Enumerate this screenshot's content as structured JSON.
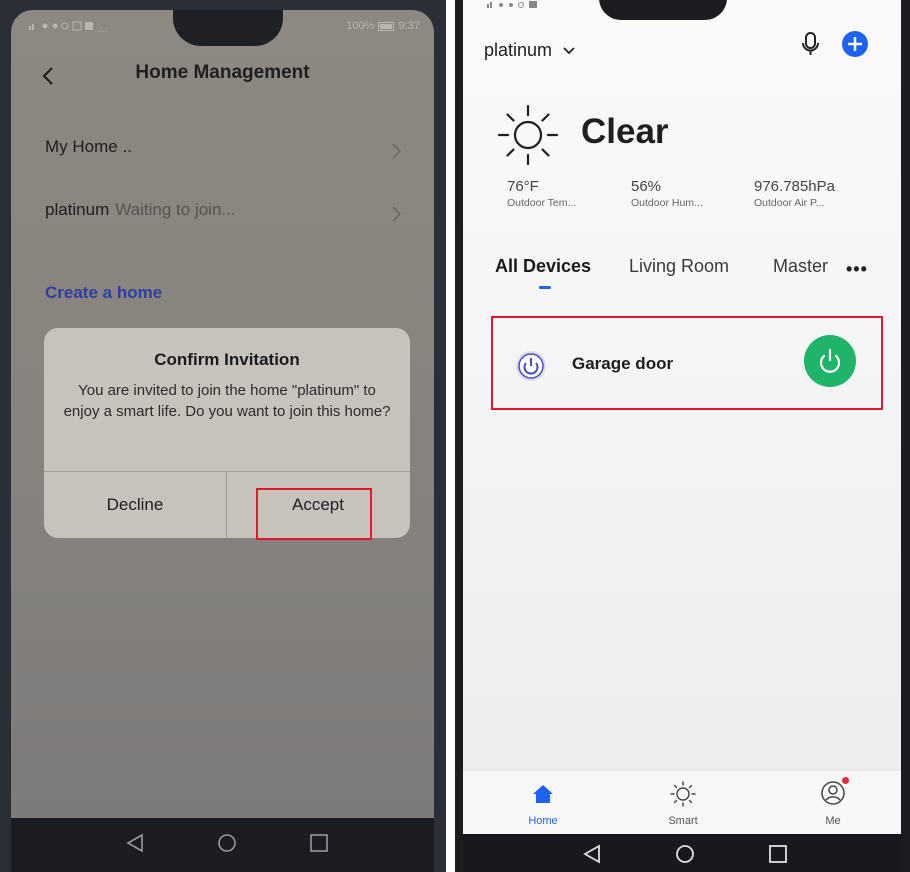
{
  "left": {
    "status": {
      "left_icons": "…",
      "battery": "100%",
      "time": "9:37"
    },
    "header": {
      "title": "Home Management"
    },
    "rows": [
      {
        "name": "My Home ..",
        "status": ""
      },
      {
        "name": "platinum",
        "status": "Waiting to join..."
      }
    ],
    "create_home": "Create a home",
    "dialog": {
      "title": "Confirm Invitation",
      "message": "You are invited to join the home \"platinum\" to enjoy a smart life. Do you want to join this home?",
      "decline": "Decline",
      "accept": "Accept"
    }
  },
  "right": {
    "home_name": "platinum",
    "weather": {
      "condition": "Clear",
      "temp": {
        "value": "76°F",
        "label": "Outdoor Tem..."
      },
      "humidity": {
        "value": "56%",
        "label": "Outdoor Hum..."
      },
      "pressure": {
        "value": "976.785hPa",
        "label": "Outdoor Air P..."
      }
    },
    "tabs": [
      "All Devices",
      "Living Room",
      "Master"
    ],
    "more": "•••",
    "device": {
      "name": "Garage door",
      "power": "on"
    },
    "bottom_nav": [
      {
        "label": "Home",
        "icon": "home-icon",
        "active": true
      },
      {
        "label": "Smart",
        "icon": "sun-icon",
        "active": false
      },
      {
        "label": "Me",
        "icon": "profile-icon",
        "active": false
      }
    ],
    "colors": {
      "accent": "#1e62f0",
      "power_on": "#20b36a",
      "highlight": "#e0182a"
    }
  }
}
